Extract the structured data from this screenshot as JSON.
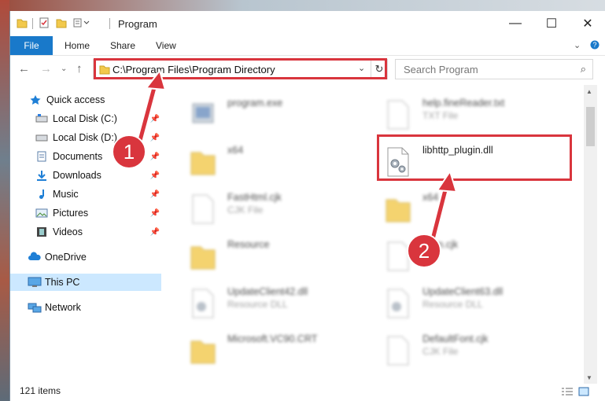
{
  "window": {
    "title": "Program"
  },
  "ribbon": {
    "tabs": [
      "File",
      "Home",
      "Share",
      "View"
    ]
  },
  "address": {
    "path": "C:\\Program Files\\Program Directory"
  },
  "search": {
    "placeholder": "Search Program"
  },
  "sidebar": {
    "items": [
      {
        "label": "Quick access",
        "icon": "star-icon"
      },
      {
        "label": "Local Disk (C:)",
        "icon": "drive-icon"
      },
      {
        "label": "Local Disk (D:)",
        "icon": "drive-icon"
      },
      {
        "label": "Documents",
        "icon": "documents-icon"
      },
      {
        "label": "Downloads",
        "icon": "downloads-icon"
      },
      {
        "label": "Music",
        "icon": "music-icon"
      },
      {
        "label": "Pictures",
        "icon": "pictures-icon"
      },
      {
        "label": "Videos",
        "icon": "videos-icon"
      },
      {
        "label": "OneDrive",
        "icon": "cloud-icon"
      },
      {
        "label": "This PC",
        "icon": "computer-icon"
      },
      {
        "label": "Network",
        "icon": "network-icon"
      }
    ]
  },
  "files": [
    {
      "name": "program.exe",
      "type": ""
    },
    {
      "name": "help.fineReader.txt",
      "type": "TXT File"
    },
    {
      "name": "x64",
      "type": ""
    },
    {
      "name": "libhttp_plugin.dll",
      "type": ""
    },
    {
      "name": "FastHtml.cjk",
      "type": "CJK File"
    },
    {
      "name": "x64",
      "type": ""
    },
    {
      "name": "Resource",
      "type": ""
    },
    {
      "name": "Korn.cjk",
      "type": "File"
    },
    {
      "name": "UpdateClient42.dll",
      "type": "Resource DLL"
    },
    {
      "name": "UpdateClient63.dll",
      "type": "Resource DLL"
    },
    {
      "name": "Microsoft.VC90.CRT",
      "type": ""
    },
    {
      "name": "DefaultFont.cjk",
      "type": "CJK File"
    }
  ],
  "status": {
    "items_count": "121 items"
  },
  "callouts": [
    "1",
    "2"
  ],
  "colors": {
    "accent": "#1979ca",
    "highlight": "#d9353d",
    "selected": "#cce8ff"
  }
}
